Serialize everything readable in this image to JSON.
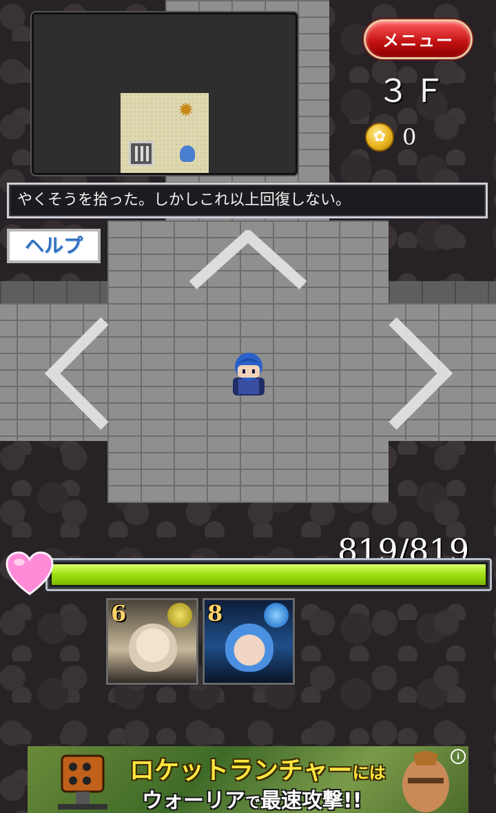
{
  "header": {
    "menu_label": "メニュー",
    "floor": "３Ｆ",
    "coins": "0"
  },
  "message": "やくそうを拾った。しかしこれ以上回復しない。",
  "help_label": "ヘルプ",
  "hp": {
    "text": "819/819",
    "current": 819,
    "max": 819,
    "bar_color": "#9bdc0c"
  },
  "party": [
    {
      "level": "6",
      "emblem_color": "#c9b21a"
    },
    {
      "level": "8",
      "emblem_color": "#2a7fd6"
    }
  ],
  "ad": {
    "line1": "ロケットランチャー",
    "line1_suffix": "には",
    "line2": "ウォーリア",
    "line2_mid": "で",
    "line2_end": "最速攻撃!!",
    "info_icon": "ⓘ"
  },
  "icons": {
    "coin": "coin-icon",
    "heart": "heart-icon",
    "arrows": [
      "arrow-up-icon",
      "arrow-left-icon",
      "arrow-right-icon"
    ]
  },
  "colors": {
    "menu_red": "#c01010",
    "help_text": "#2f6fc0",
    "hp_green": "#9bdc0c",
    "heart_pink": "#ff7fd0"
  }
}
